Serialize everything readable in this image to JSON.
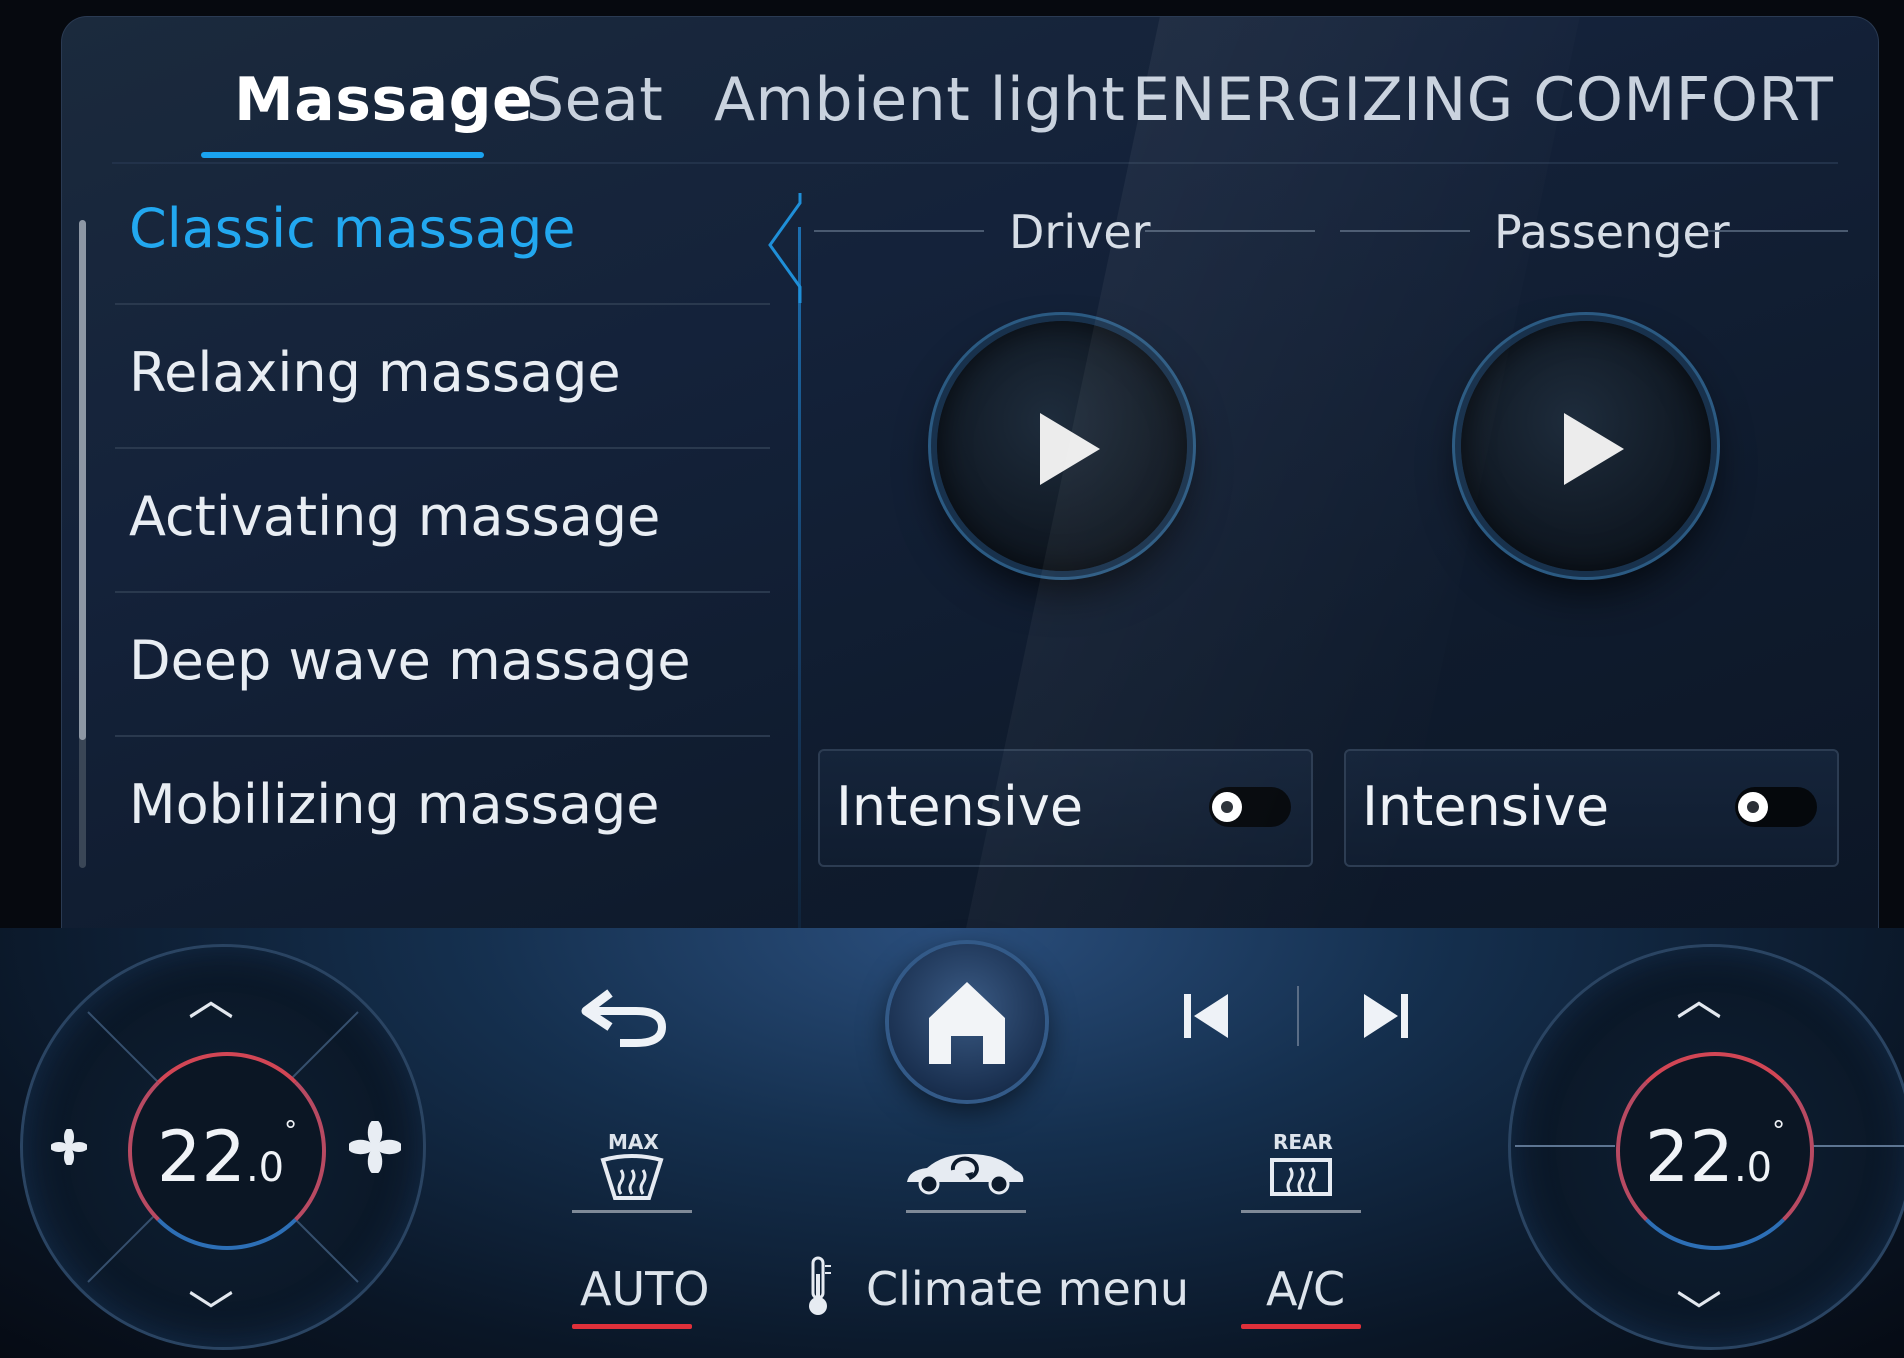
{
  "tabs": [
    {
      "label": "Massage",
      "active": true
    },
    {
      "label": "Seat",
      "active": false
    },
    {
      "label": "Ambient light",
      "active": false
    },
    {
      "label": "ENERGIZING COMFORT",
      "active": false
    }
  ],
  "massage_list": [
    {
      "label": "Classic massage",
      "active": true
    },
    {
      "label": "Relaxing massage",
      "active": false
    },
    {
      "label": "Activating massage",
      "active": false
    },
    {
      "label": "Deep wave massage",
      "active": false
    },
    {
      "label": "Mobilizing massage",
      "active": false
    }
  ],
  "driver": {
    "label": "Driver",
    "play_icon": "play-icon",
    "intensive_label": "Intensive",
    "intensive_on": false
  },
  "passenger": {
    "label": "Passenger",
    "play_icon": "play-icon",
    "intensive_label": "Intensive",
    "intensive_on": false
  },
  "climate": {
    "left_temp": {
      "whole": "22",
      "decimal": ".0",
      "unit": "°"
    },
    "right_temp": {
      "whole": "22",
      "decimal": ".0",
      "unit": "°"
    },
    "max_defrost_label": "MAX",
    "rear_defrost_label": "REAR",
    "auto_label": "AUTO",
    "climate_menu_label": "Climate menu",
    "ac_label": "A/C",
    "accent_color": "#1aa3f0",
    "indicator_color": "#e0303a"
  }
}
